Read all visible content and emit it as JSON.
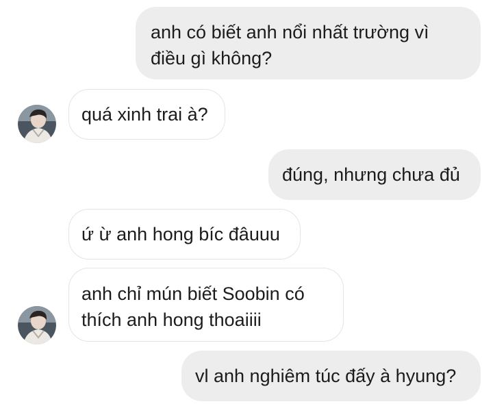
{
  "messages": [
    {
      "side": "out",
      "text": "anh có biết anh nổi nhất trường vì\nđiều gì không?"
    },
    {
      "side": "in",
      "text": "quá xinh trai à?",
      "avatar": true
    },
    {
      "side": "out",
      "text": "đúng, nhưng chưa đủ"
    },
    {
      "side": "in",
      "text": "ứ ừ anh hong bíc đâuuu"
    },
    {
      "side": "in",
      "text": "anh chỉ mún biết Soobin có\nthích anh hong thoaiiii",
      "avatar": true
    },
    {
      "side": "out",
      "text": "vl anh nghiêm túc đấy à hyung?"
    }
  ],
  "colors": {
    "outgoing_bubble": "#ededed",
    "incoming_bubble": "#ffffff",
    "incoming_border": "#e4e4e4",
    "text": "#1c1c1c"
  },
  "icons": {
    "avatar": "contact-avatar-icon"
  }
}
